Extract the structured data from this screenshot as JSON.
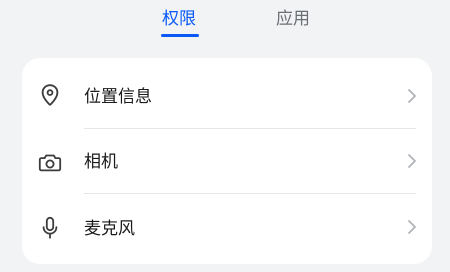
{
  "tabs": [
    {
      "label": "权限",
      "active": true
    },
    {
      "label": "应用",
      "active": false
    }
  ],
  "permissions": {
    "items": [
      {
        "label": "位置信息",
        "icon": "location-pin-icon"
      },
      {
        "label": "相机",
        "icon": "camera-icon"
      },
      {
        "label": "麦克风",
        "icon": "microphone-icon"
      }
    ]
  },
  "colors": {
    "accent": "#0a59f7",
    "background": "#f1f3f5",
    "card": "#ffffff",
    "text_primary": "#1a1a1a",
    "text_secondary": "#6b6e73",
    "icon": "#3c3c3c",
    "chevron": "#b0b3b8",
    "divider": "#e6e6e6"
  }
}
